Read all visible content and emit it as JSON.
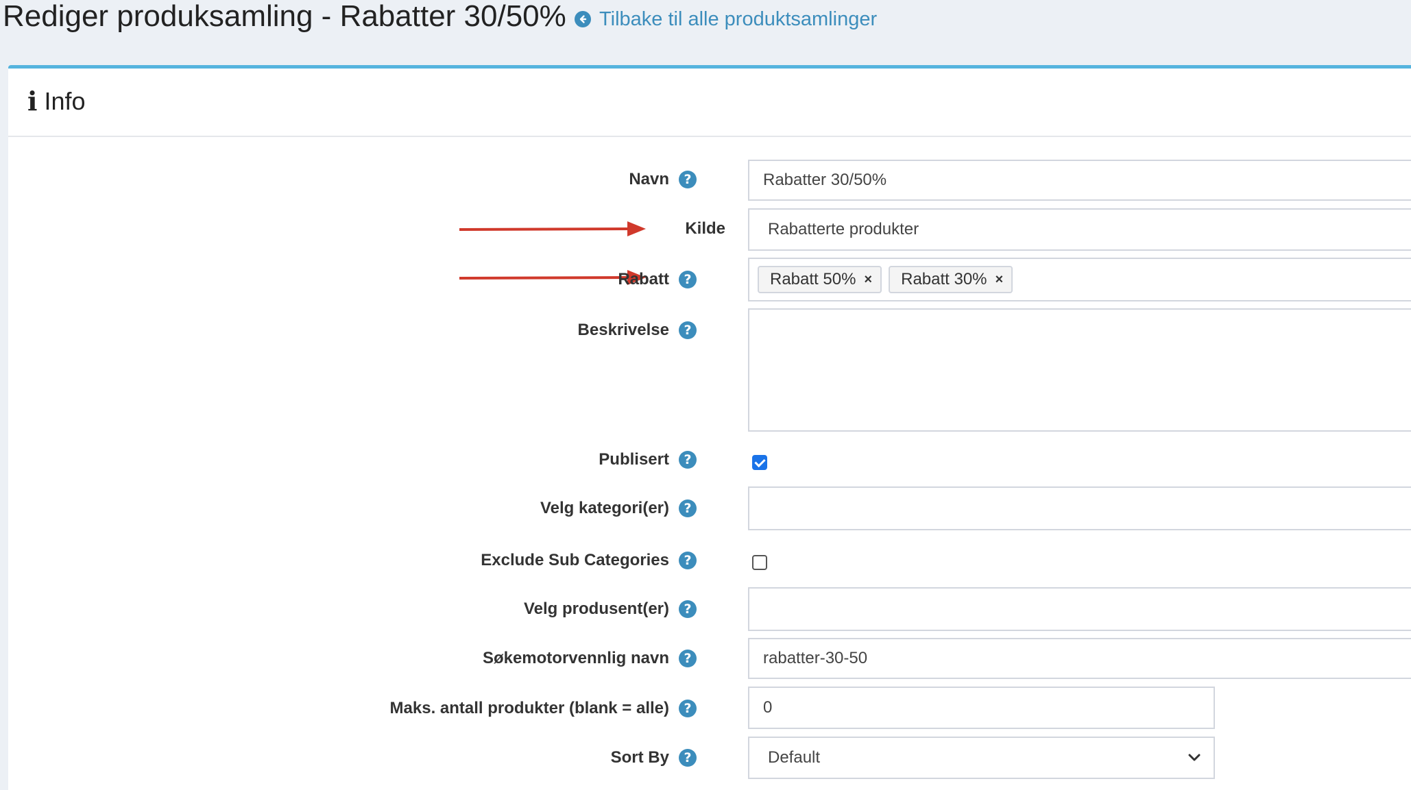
{
  "header": {
    "title": "Rediger produksamling - Rabatter 30/50%",
    "back_link": "Tilbake til alle produktsamlinger"
  },
  "card": {
    "title": "Info"
  },
  "form": {
    "navn": {
      "label": "Navn",
      "value": "Rabatter 30/50%"
    },
    "kilde": {
      "label": "Kilde",
      "value": "Rabatterte produkter"
    },
    "rabatt": {
      "label": "Rabatt",
      "tags": [
        "Rabatt 50%",
        "Rabatt 30%"
      ],
      "remove": "×"
    },
    "beskrivelse": {
      "label": "Beskrivelse",
      "value": ""
    },
    "publisert": {
      "label": "Publisert",
      "checked": true
    },
    "kategorier": {
      "label": "Velg kategori(er)",
      "value": ""
    },
    "exclude_sub": {
      "label": "Exclude Sub Categories",
      "checked": false
    },
    "produsenter": {
      "label": "Velg produsent(er)",
      "value": ""
    },
    "seo_name": {
      "label": "Søkemotorvennlig navn",
      "value": "rabatter-30-50"
    },
    "max_products": {
      "label": "Maks. antall produkter (blank = alle)",
      "value": "0"
    },
    "sort_by": {
      "label": "Sort By",
      "value": "Default"
    }
  },
  "help_glyph": "?",
  "colors": {
    "accent": "#3c8dbc",
    "card_border": "#55b4de",
    "arrow": "#d0392b",
    "checkbox": "#1a73e8"
  }
}
